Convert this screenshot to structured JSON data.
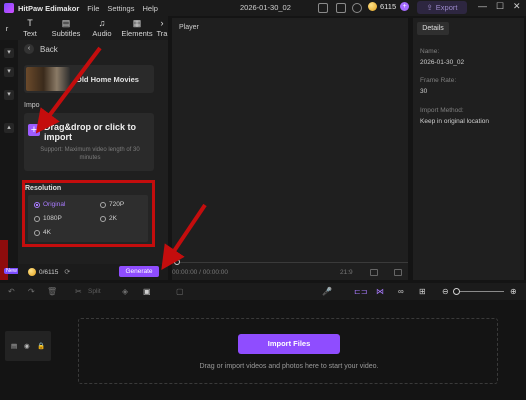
{
  "app": {
    "name": "HitPaw Edimakor",
    "project_name": "2026-01-30_02",
    "credits": "6115",
    "export_label": "Export"
  },
  "menu": [
    "File",
    "Settings",
    "Help"
  ],
  "window_controls": {
    "minimize": "—",
    "maximize": "☐",
    "close": "✕"
  },
  "toolbar": {
    "tools": [
      {
        "label": "Text",
        "icon": "text-icon"
      },
      {
        "label": "Subtitles",
        "icon": "subtitles-icon"
      },
      {
        "label": "Audio",
        "icon": "audio-icon"
      },
      {
        "label": "Elements",
        "icon": "elements-icon"
      }
    ],
    "more_label": "Tra"
  },
  "panel": {
    "back_label": "Back",
    "media_title": "Old Home Movies",
    "import_section": "Impo",
    "dropzone_title": "Drag&drop or click to import",
    "dropzone_sub": "Support: Maximum video length of 30 minutes",
    "resolution_title": "Resolution",
    "resolution_options": [
      "Original",
      "720P",
      "1080P",
      "2K",
      "4K"
    ],
    "resolution_selected": "Original",
    "footer_credits": "0/6115",
    "generate_label": "Generate",
    "new_badge": "New"
  },
  "player": {
    "title": "Player",
    "timecode": "00:00:00 / 00:00:00",
    "ratio": "21:9"
  },
  "details": {
    "tab": "Details",
    "name_label": "Name:",
    "name_value": "2026-01-30_02",
    "frame_rate_label": "Frame Rate:",
    "frame_rate_value": "30",
    "import_method_label": "Import Method:",
    "import_method_value": "Keep in original location"
  },
  "timeline": {
    "split_label": "Split",
    "import_files_label": "Import Files",
    "drop_hint": "Drag or import videos and photos here to start your video."
  },
  "colors": {
    "accent": "#8f4dff",
    "highlight_red": "#c40d0d"
  }
}
